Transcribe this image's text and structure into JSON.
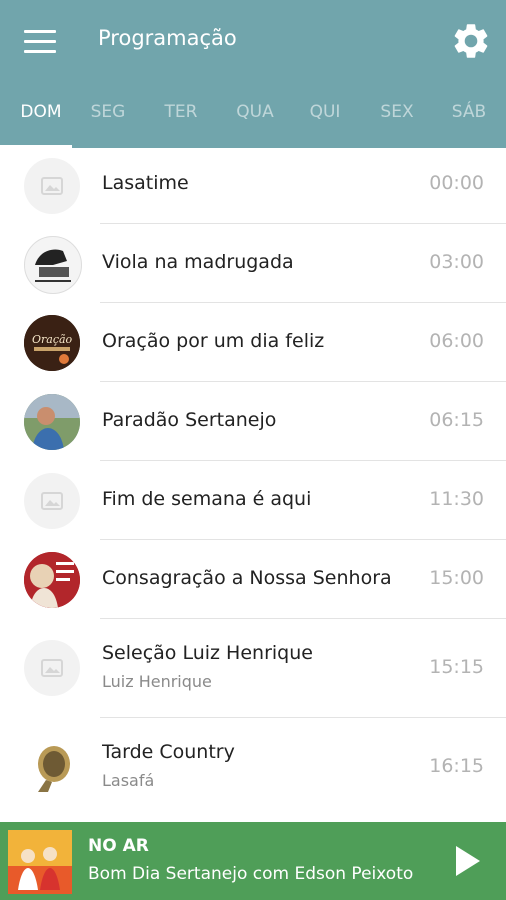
{
  "header": {
    "title": "Programação",
    "menu_icon": "hamburger-menu-icon",
    "settings_icon": "gear-icon",
    "background": "#71a5ac"
  },
  "tabs": [
    {
      "label": "DOM",
      "active": true
    },
    {
      "label": "SEG",
      "active": false
    },
    {
      "label": "TER",
      "active": false
    },
    {
      "label": "QUA",
      "active": false
    },
    {
      "label": "QUI",
      "active": false
    },
    {
      "label": "SEX",
      "active": false
    },
    {
      "label": "SÁB",
      "active": false
    }
  ],
  "programs": [
    {
      "name": "Lasatime",
      "host": "",
      "time": "00:00",
      "image": "placeholder"
    },
    {
      "name": "Viola na madrugada",
      "host": "",
      "time": "03:00",
      "image": "photo"
    },
    {
      "name": "Oração por um dia feliz",
      "host": "",
      "time": "06:00",
      "image": "photo"
    },
    {
      "name": "Paradão Sertanejo",
      "host": "",
      "time": "06:15",
      "image": "photo"
    },
    {
      "name": "Fim de semana é aqui",
      "host": "",
      "time": "11:30",
      "image": "placeholder"
    },
    {
      "name": "Consagração a Nossa Senhora",
      "host": "",
      "time": "15:00",
      "image": "photo"
    },
    {
      "name": "Seleção Luiz Henrique",
      "host": "Luiz Henrique",
      "time": "15:15",
      "image": "placeholder"
    },
    {
      "name": "Tarde Country",
      "host": "Lasafá",
      "time": "16:15",
      "image": "photo"
    }
  ],
  "player": {
    "label": "NO AR",
    "now_playing": "Bom Dia Sertanejo com Edson Peixoto",
    "play_icon": "play-icon",
    "background": "#4f9e58"
  }
}
